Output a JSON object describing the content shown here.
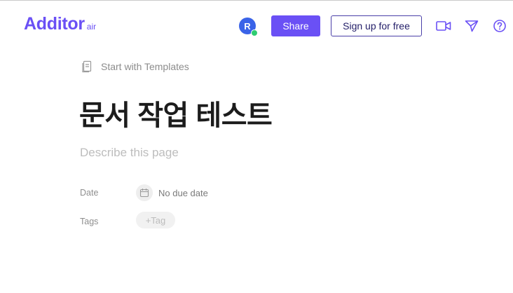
{
  "app": {
    "logo_main": "Additor",
    "logo_sub": "air"
  },
  "header": {
    "avatar_initial": "R",
    "share_label": "Share",
    "signup_label": "Sign up for free",
    "icons": [
      "video-icon",
      "send-icon",
      "help-icon"
    ]
  },
  "page": {
    "templates_link": "Start with Templates",
    "title": "문서 작업 테스트",
    "description_placeholder": "Describe this page",
    "properties": {
      "date_label": "Date",
      "date_value": "No due date",
      "tags_label": "Tags",
      "tag_add": "+Tag"
    }
  },
  "colors": {
    "accent": "#6a50f5",
    "avatar_bg": "#3a63e8",
    "online": "#2ecc71",
    "signup_border": "#4a3fa8"
  }
}
